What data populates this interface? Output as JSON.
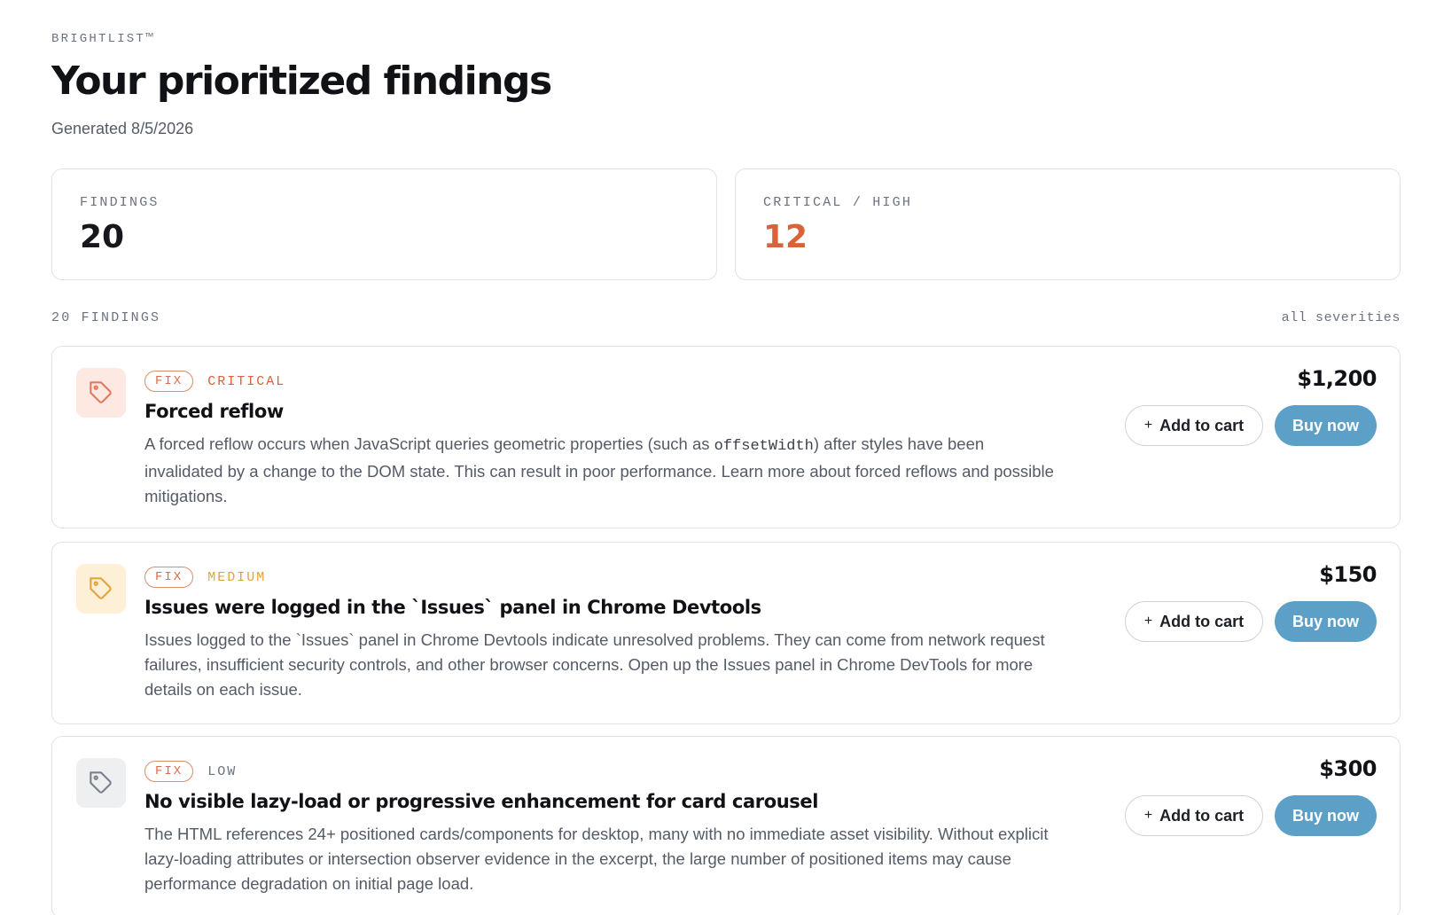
{
  "brand": "BRIGHTLIST™",
  "title": "Your prioritized findings",
  "generated": "Generated 8/5/2026",
  "stats": {
    "findings": {
      "label": "FINDINGS",
      "value": "20",
      "color": "#16181d"
    },
    "critical_high": {
      "label": "CRITICAL / HIGH",
      "value": "12",
      "color": "#d9623b"
    }
  },
  "list": {
    "count_label": "20 FINDINGS",
    "filter_label": "all severities"
  },
  "cards": [
    {
      "badge": "FIX",
      "severity": "CRITICAL",
      "severity_color": "#d9623b",
      "icon": "tag-icon",
      "icon_bg": "#fde8e2",
      "icon_color": "#e07a5f",
      "title": "Forced reflow",
      "desc_before": "A forced reflow occurs when JavaScript queries geometric properties (such as ",
      "desc_code": "offsetWidth",
      "desc_after": ") after styles have been invalidated by a change to the DOM state. This can result in poor performance. Learn more about forced reflows and possible mitigations.",
      "price": "$1,200",
      "cart_label": "Add to cart",
      "buy_label": "Buy now"
    },
    {
      "badge": "FIX",
      "severity": "MEDIUM",
      "severity_color": "#e0a33a",
      "icon": "tag-icon",
      "icon_bg": "#fdf0d6",
      "icon_color": "#e2a43c",
      "title": "Issues were logged in the `Issues` panel in Chrome Devtools",
      "desc": "Issues logged to the `Issues` panel in Chrome Devtools indicate unresolved problems. They can come from network request failures, insufficient security controls, and other browser concerns. Open up the Issues panel in Chrome DevTools for more details on each issue.",
      "price": "$150",
      "cart_label": "Add to cart",
      "buy_label": "Buy now"
    },
    {
      "badge": "FIX",
      "severity": "LOW",
      "severity_color": "#6b7280",
      "icon": "tag-icon",
      "icon_bg": "#eeeff1",
      "icon_color": "#7b808a",
      "title": "No visible lazy-load or progressive enhancement for card carousel",
      "desc": "The HTML references 24+ positioned cards/components for desktop, many with no immediate asset visibility. Without explicit lazy-loading attributes or intersection observer evidence in the excerpt, the large number of positioned items may cause performance degradation on initial page load.",
      "price": "$300",
      "cart_label": "Add to cart",
      "buy_label": "Buy now"
    }
  ],
  "colors": {
    "accent_button": "#5da0c7",
    "fix_pill": "#d96d4a"
  }
}
